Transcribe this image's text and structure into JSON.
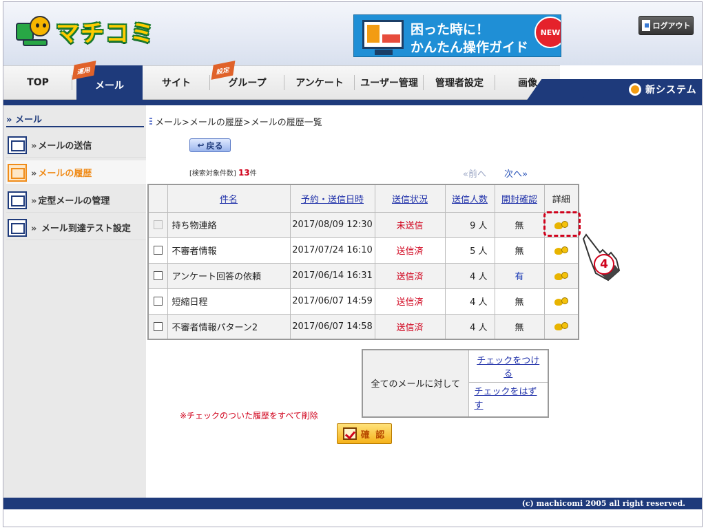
{
  "header": {
    "logo_text": "マチコミ",
    "guide_banner": {
      "line1": "困った時に！",
      "line2": "かんたん操作ガイド",
      "badge": "NEW"
    },
    "logout_label": "ログアウト"
  },
  "nav": {
    "tabs": [
      {
        "label": "TOP"
      },
      {
        "label": "メール",
        "flag": "運用"
      },
      {
        "label": "サイト"
      },
      {
        "label": "グループ",
        "flag": "設定"
      },
      {
        "label": "アンケート"
      },
      {
        "label": "ユーザー管理"
      },
      {
        "label": "管理者設定"
      },
      {
        "label": "画像"
      }
    ],
    "new_system": "新システム"
  },
  "sidebar": {
    "heading": "メール",
    "items": [
      {
        "label": "メールの送信"
      },
      {
        "label": "メールの履歴"
      },
      {
        "label": "定型メールの管理"
      },
      {
        "label": " メール到達テスト設定"
      }
    ]
  },
  "main": {
    "breadcrumb": "メール>メールの履歴>メールの履歴一覧",
    "back_label": "戻る",
    "count_label": "[検索対象件数]",
    "count_value": "13",
    "count_unit": "件",
    "prev_label": "前へ",
    "next_label": "次へ",
    "table": {
      "headers": [
        "件名",
        "予約・送信日時",
        "送信状況",
        "送信人数",
        "開封確認",
        "詳細"
      ],
      "rows": [
        {
          "subject": "持ち物連絡",
          "date": "2017/08/09 12:30",
          "status": "未送信",
          "count": "9 人",
          "opened": "無"
        },
        {
          "subject": "不審者情報",
          "date": "2017/07/24 16:10",
          "status": "送信済",
          "count": "5 人",
          "opened": "無"
        },
        {
          "subject": "アンケート回答の依頼",
          "date": "2017/06/14 16:31",
          "status": "送信済",
          "count": "4 人",
          "opened": "有"
        },
        {
          "subject": "短縮日程",
          "date": "2017/06/07 14:59",
          "status": "送信済",
          "count": "4 人",
          "opened": "無"
        },
        {
          "subject": "不審者情報パターン2",
          "date": "2017/06/07 14:58",
          "status": "送信済",
          "count": "4 人",
          "opened": "無"
        }
      ]
    },
    "step_number": "4",
    "check_panel": {
      "label": "全てのメールに対して",
      "check_all": "チェックをつける",
      "uncheck_all_1": "チェックをはず",
      "uncheck_all_2": "す"
    },
    "delete_note": "※チェックのついた履歴をすべて削除",
    "confirm_label": "確 認"
  },
  "footer": {
    "copyright": "(c) machicomi 2005 all right reserved."
  }
}
